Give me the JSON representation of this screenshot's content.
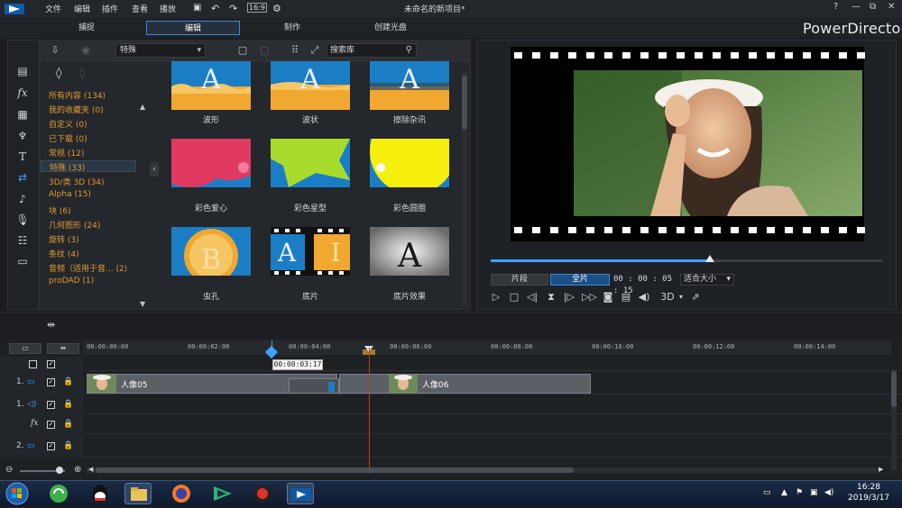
{
  "menu": {
    "file": "文件",
    "edit": "编辑",
    "plugins": "插件",
    "view": "查看",
    "play": "播放"
  },
  "window": {
    "title": "未命名的新项目*",
    "brand": "PowerDirector",
    "help": "?",
    "minimize": "—",
    "restore": "⧉",
    "close": "✕"
  },
  "tabs": {
    "capture": "捕捉",
    "edit": "编辑",
    "produce": "制作",
    "disc": "创建光盘"
  },
  "library": {
    "category_select": "特殊",
    "search_placeholder": "搜索库",
    "categories": [
      {
        "label": "所有内容 (134)"
      },
      {
        "label": "我的收藏夹 (0)"
      },
      {
        "label": "自定义 (0)"
      },
      {
        "label": "已下载 (0)"
      },
      {
        "label": "常规 (12)"
      },
      {
        "label": "特殊 (33)"
      },
      {
        "label": "3D/类 3D (34)"
      },
      {
        "label": "Alpha (15)"
      },
      {
        "label": "块 (6)"
      },
      {
        "label": "几何图形 (24)"
      },
      {
        "label": "旋转 (3)"
      },
      {
        "label": "条纹 (4)"
      },
      {
        "label": "音频（适用于音... (2)"
      },
      {
        "label": "proDAD (1)"
      }
    ],
    "transitions": [
      {
        "label": "波形"
      },
      {
        "label": "波状"
      },
      {
        "label": "擦除杂讯"
      },
      {
        "label": "彩色爱心"
      },
      {
        "label": "彩色星型"
      },
      {
        "label": "彩色圆圈"
      },
      {
        "label": "虫孔"
      },
      {
        "label": "底片"
      },
      {
        "label": "底片效果"
      }
    ]
  },
  "preview": {
    "mode_clip": "片段",
    "mode_full": "全片",
    "timecode": "00 : 00 : 05 : 15",
    "fit": "适合大小",
    "three_d": "3D",
    "progress": 0.56
  },
  "timeline": {
    "ruler_ticks": [
      "00:00:00:00",
      "00:00:02:00",
      "00:00:04:00",
      "00:00:06:00",
      "00:00:08:00",
      "00:00:10:00",
      "00:00:12:00",
      "00:00:14:00"
    ],
    "tooltip": "00:00:03:17",
    "tracks": [
      {
        "num": "1."
      },
      {
        "num": "1."
      },
      {
        "num": ""
      },
      {
        "num": "2."
      }
    ],
    "clips": [
      {
        "label": "人像05"
      },
      {
        "label": "人像06"
      }
    ],
    "fx_label": "fx"
  },
  "taskbar": {
    "time": "16:28",
    "date": "2019/3/17"
  },
  "colors": {
    "accent": "#3fa1ff",
    "category": "#e09a32",
    "playhead": "#c0392b"
  }
}
